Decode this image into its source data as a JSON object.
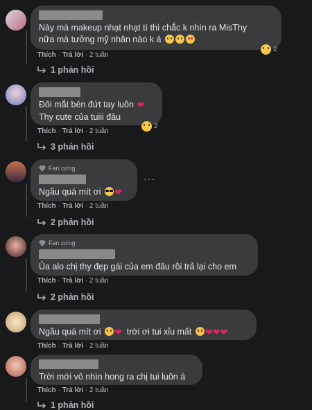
{
  "comments": [
    {
      "text": "Này mà makeup nhạt nhạt tí thì chắc k nhìn ra MisThy",
      "text2": "nữa mà tưởng mỹ nhân nào k á",
      "like": "Thích",
      "reply": "Trả lời",
      "time": "2 tuần",
      "reaction_count": "2",
      "replies": "1 phản hồi"
    },
    {
      "text": "Đôi mắt bén đứt tay luôn",
      "text2": "Thy cute của tuiii đâu",
      "like": "Thích",
      "reply": "Trả lời",
      "time": "2 tuần",
      "reaction_count": "2",
      "replies": "3 phản hồi"
    },
    {
      "badge": "Fan cứng",
      "text": "Ngầu quá mít ơi",
      "like": "Thích",
      "reply": "Trả lời",
      "time": "2 tuần",
      "replies": "2 phản hồi",
      "more": "···"
    },
    {
      "badge": "Fan cứng",
      "text": "Ủa alo chị thy đẹp gái của em đâu rồi trả lại cho em",
      "like": "Thích",
      "reply": "Trả lời",
      "time": "2 tuần",
      "replies": "2 phản hồi"
    },
    {
      "text": "Ngầu quá mít ơi",
      "text_mid": "trời ơi tui xỉu mất",
      "like": "Thích",
      "reply": "Trả lời",
      "time": "2 tuần"
    },
    {
      "text": "Trời mới vô nhìn hong ra chị tui luôn á",
      "like": "Thích",
      "reply": "Trả lời",
      "time": "2 tuần",
      "replies": "1 phản hồi"
    }
  ],
  "colors": {
    "background": "#18191a",
    "bubble": "#3a3b3c",
    "heart": "#e0245e",
    "muted": "#b0b3b8"
  },
  "icons": [
    "reply-arrow-icon",
    "diamond-icon",
    "heart-icon",
    "emoji-icon",
    "more-options-icon"
  ]
}
